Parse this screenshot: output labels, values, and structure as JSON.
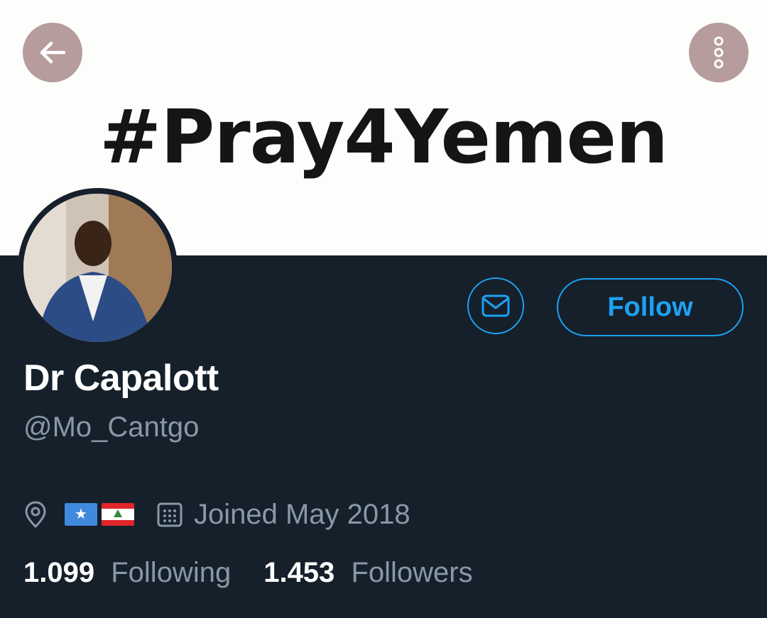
{
  "header": {
    "banner_text": "#Pray4Yemen",
    "back_icon": "arrow-left-icon",
    "more_icon": "more-vertical-icon"
  },
  "profile": {
    "name": "Dr Capalott",
    "handle": "@Mo_Cantgo",
    "follow_label": "Follow",
    "message_icon": "mail-icon",
    "location_icon": "location-pin-icon",
    "location_flags": [
      "flag-somalia",
      "flag-lebanon"
    ],
    "calendar_icon": "calendar-icon",
    "joined": "Joined May 2018"
  },
  "stats": {
    "following_count": "1.099",
    "following_label": "Following",
    "followers_count": "1.453",
    "followers_label": "Followers"
  },
  "colors": {
    "background": "#15202b",
    "accent": "#1da1f2",
    "secondary_text": "#8899a6",
    "header_button": "#b69c9c"
  }
}
